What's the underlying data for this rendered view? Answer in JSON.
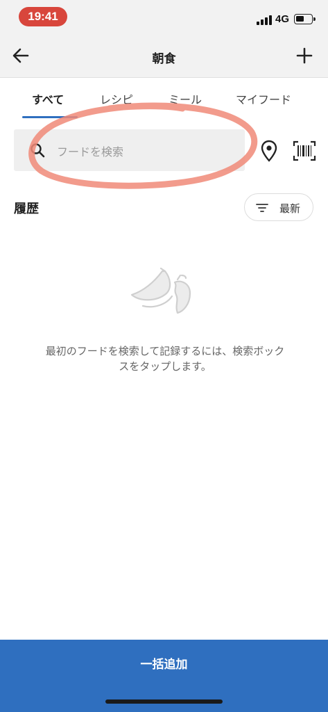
{
  "status_bar": {
    "time": "19:41",
    "network": "4G",
    "battery_level": 0.55
  },
  "header": {
    "title": "朝食",
    "back_icon": "arrow-left-icon",
    "add_icon": "plus-icon"
  },
  "tabs": [
    {
      "label": "すべて",
      "active": true
    },
    {
      "label": "レシピ",
      "active": false
    },
    {
      "label": "ミール",
      "active": false
    },
    {
      "label": "マイフード",
      "active": false
    }
  ],
  "search": {
    "placeholder": "フードを検索",
    "value": ""
  },
  "history": {
    "title": "履歴",
    "sort_label": "最新"
  },
  "empty_state": {
    "message": "最初のフードを検索して記録するには、検索ボックスをタップします。"
  },
  "footer": {
    "bulk_add_label": "一括追加"
  },
  "colors": {
    "accent": "#2f6fbf",
    "time_pill": "#d8463c",
    "annotation": "#f08a78"
  }
}
